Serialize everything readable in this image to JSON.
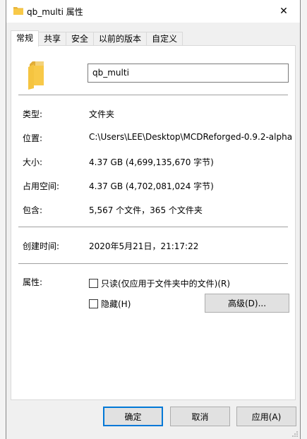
{
  "window": {
    "title": "qb_multi 属性",
    "close_glyph": "✕"
  },
  "tabs": [
    {
      "label": "常规",
      "active": true
    },
    {
      "label": "共享",
      "active": false
    },
    {
      "label": "安全",
      "active": false
    },
    {
      "label": "以前的版本",
      "active": false
    },
    {
      "label": "自定义",
      "active": false
    }
  ],
  "general": {
    "folder_name": "qb_multi",
    "type_label": "类型:",
    "type_value": "文件夹",
    "location_label": "位置:",
    "location_value": "C:\\Users\\LEE\\Desktop\\MCDReforged-0.9.2-alpha",
    "size_label": "大小:",
    "size_value": "4.37 GB (4,699,135,670 字节)",
    "disk_size_label": "占用空间:",
    "disk_size_value": "4.37 GB (4,702,081,024 字节)",
    "contains_label": "包含:",
    "contains_value": "5,567 个文件，365 个文件夹",
    "created_label": "创建时间:",
    "created_value": "2020年5月21日，21:17:22",
    "attributes_label": "属性:",
    "readonly_label": "只读(仅应用于文件夹中的文件)(R)",
    "hidden_label": "隐藏(H)",
    "advanced_button": "高级(D)..."
  },
  "buttons": {
    "ok": "确定",
    "cancel": "取消",
    "apply": "应用(A)"
  },
  "colors": {
    "folder": "#f8c948",
    "accent": "#0078d7"
  }
}
